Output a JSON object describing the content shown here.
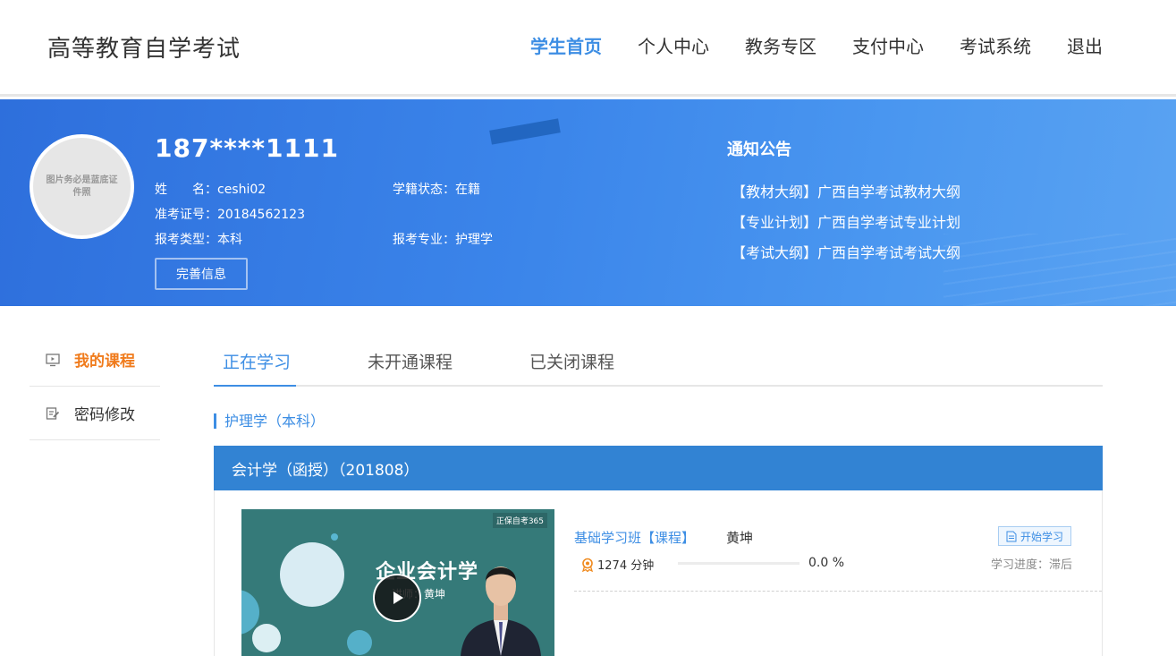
{
  "header": {
    "site_title": "高等教育自学考试",
    "nav": [
      {
        "label": "学生首页",
        "active": true
      },
      {
        "label": "个人中心"
      },
      {
        "label": "教务专区"
      },
      {
        "label": "支付中心"
      },
      {
        "label": "考试系统"
      },
      {
        "label": "退出"
      }
    ]
  },
  "profile": {
    "avatar_text": "图片务必是蓝底证件照",
    "user_id": "187****1111",
    "name_label": "姓　　名：",
    "name": "ceshi02",
    "exam_no_label": "准考证号：",
    "exam_no": "20184562123",
    "apply_type_label": "报考类型：",
    "apply_type": "本科",
    "status_label": "学籍状态：",
    "status": "在籍",
    "major_label": "报考专业：",
    "major": "护理学",
    "complete_button": "完善信息"
  },
  "notices": {
    "title": "通知公告",
    "items": [
      "【教材大纲】广西自学考试教材大纲",
      "【专业计划】广西自学考试专业计划",
      "【考试大纲】广西自学考试考试大纲"
    ]
  },
  "sidebar": {
    "items": [
      {
        "label": "我的课程",
        "active": true
      },
      {
        "label": "密码修改"
      }
    ]
  },
  "tabs": [
    {
      "label": "正在学习",
      "active": true
    },
    {
      "label": "未开通课程"
    },
    {
      "label": "已关闭课程"
    }
  ],
  "major_section": "护理学（本科）",
  "course": {
    "header": "会计学（函授）（201808）",
    "video": {
      "title": "企业会计学",
      "teacher_text": "讲师：黄坤",
      "logo_text": "正保自考365"
    },
    "lesson_title": "基础学习班【课程】",
    "teacher": "黄坤",
    "minutes": "1274 分钟",
    "progress_percent": "0.0 %",
    "progress_value": 0,
    "start_button": "开始学习",
    "study_status": "学习进度：滞后"
  },
  "colors": {
    "accent": "#3d8ee4",
    "active_sidebar": "#f07b1c",
    "course_header": "#3283d3"
  }
}
